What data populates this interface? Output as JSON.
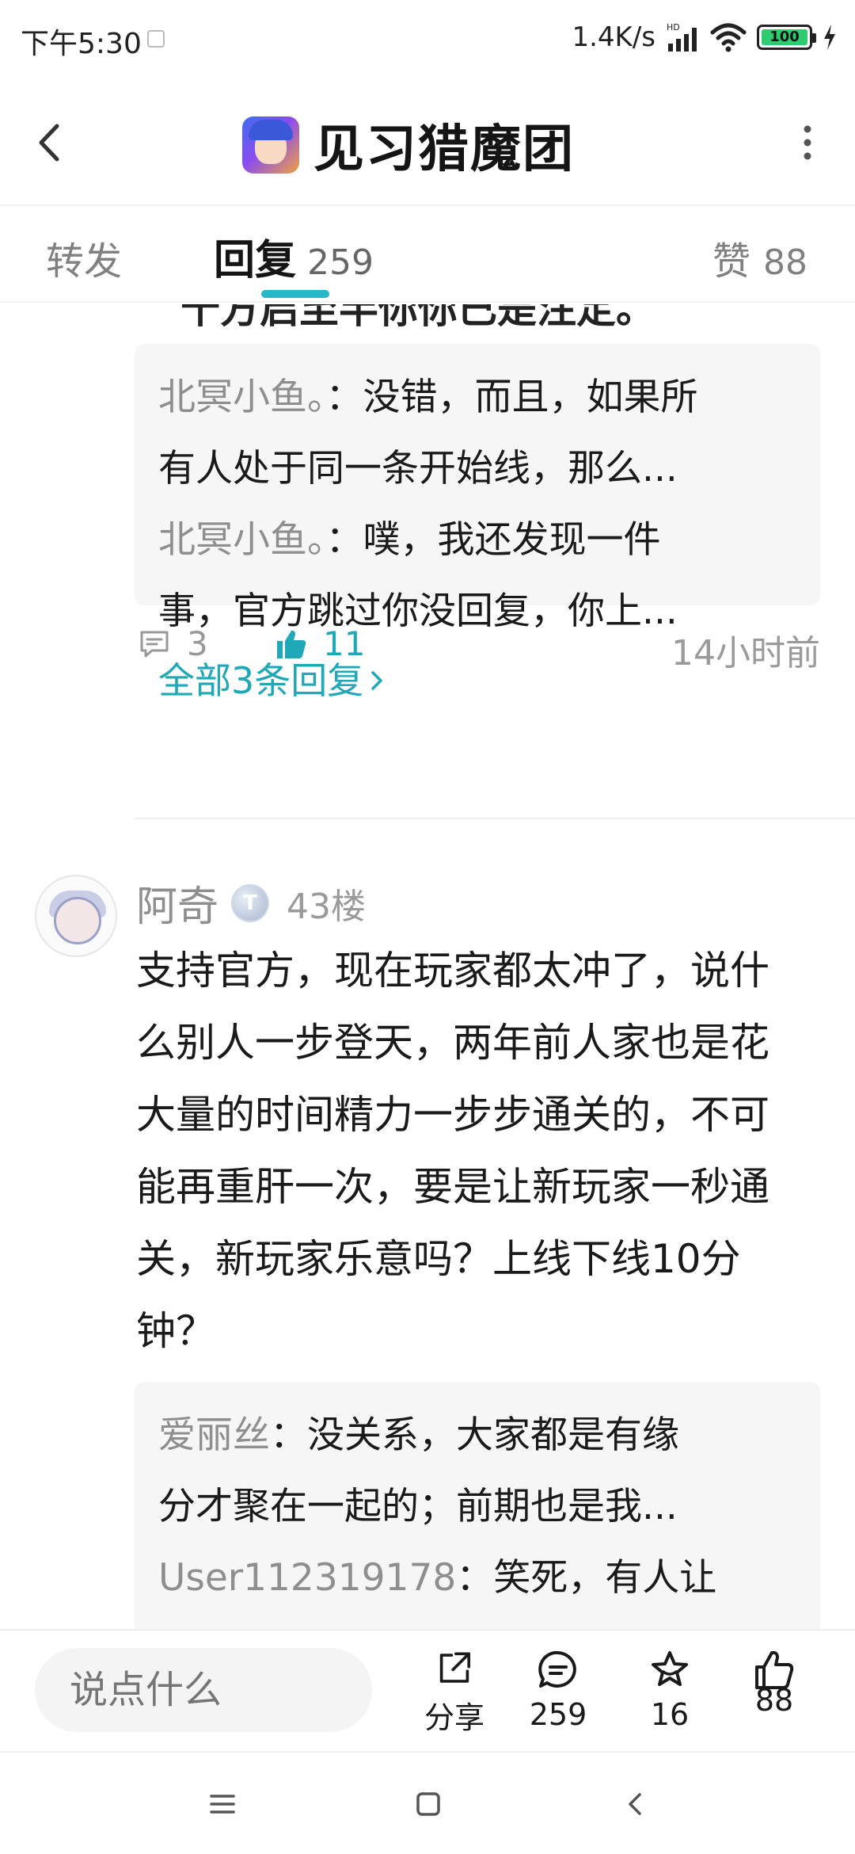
{
  "status_bar": {
    "time": "下午5:30",
    "net_speed": "1.4K/s",
    "network_tag": "HD",
    "battery": "100"
  },
  "header": {
    "title": "见习猎魔团"
  },
  "tabs": {
    "forward": "转发",
    "reply_label": "回复",
    "reply_count": "259",
    "like_label": "赞",
    "like_count": "88"
  },
  "prev_post": {
    "cut_text": "十方启至半你你已是注定。",
    "sub_replies": [
      {
        "user": "北冥小鱼。",
        "line1": "没错，而且，如果所",
        "line2": "有人处于同一条开始线，那么..."
      },
      {
        "user": "北冥小鱼。",
        "line1": "噗，我还发现一件",
        "line2": "事，官方跳过你没回复，你上..."
      }
    ],
    "all_replies": "全部3条回复",
    "comment_count": "3",
    "like_count": "11",
    "time": "14小时前"
  },
  "post": {
    "user": "阿奇",
    "level": "T",
    "floor": "43楼",
    "body": "支持官方，现在玩家都太冲了，说什么别人一步登天，两年前人家也是花大量的时间精力一步步通关的，不可能再重肝一次，要是让新玩家一秒通关，新玩家乐意吗？上线下线10分钟？",
    "sub_replies": [
      {
        "user": "爱丽丝",
        "line1": "没关系，大家都是有缘",
        "line2": "分才聚在一起的；前期也是我..."
      },
      {
        "user": "User112319178",
        "line1": "笑死，有人让",
        "line2": ""
      }
    ]
  },
  "bottom_bar": {
    "input_placeholder": "说点什么",
    "share_label": "分享",
    "comment_count": "259",
    "favorite_count": "16",
    "like_count": "88"
  },
  "colors": {
    "accent": "#1fa8b8",
    "username": "#8e8e8e",
    "text": "#1a1a1a"
  },
  "icons": [
    "back-icon",
    "more-icon",
    "comment-icon",
    "thumbs-up-icon",
    "share-icon",
    "star-icon",
    "menu-icon",
    "home-icon",
    "nav-back-icon"
  ]
}
